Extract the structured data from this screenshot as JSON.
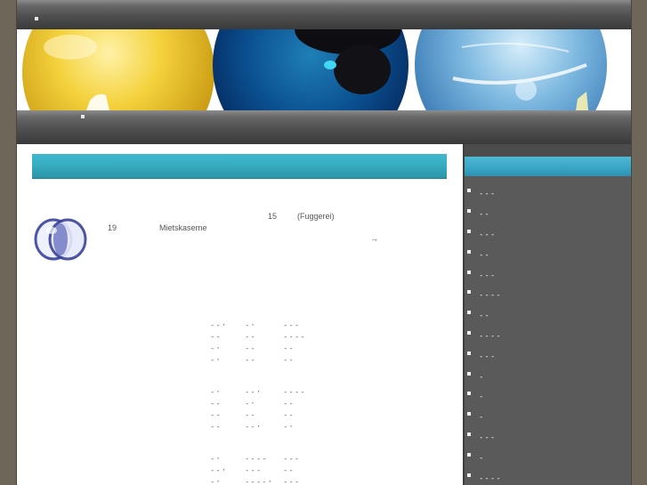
{
  "header": {
    "nav_item": "",
    "banner_alt": "decorative glass spheres"
  },
  "nav": {
    "item": ""
  },
  "post": {
    "date_number": "15",
    "place": "(Fuggerei)",
    "year_prefix": "19",
    "word": "Mietskaserne",
    "more_arrow": "→"
  },
  "tables": [
    {
      "rows": [
        [
          "--·",
          "-·",
          "---"
        ],
        [
          "--",
          "--",
          "----"
        ],
        [
          "-·",
          "--",
          "--"
        ],
        [
          "-·",
          "--",
          "--"
        ]
      ]
    },
    {
      "rows": [
        [
          "-·",
          "--·",
          "----"
        ],
        [
          "--",
          "-·",
          "--"
        ],
        [
          "--",
          "--",
          "--"
        ],
        [
          "--",
          "--·",
          "-·"
        ]
      ]
    },
    {
      "rows": [
        [
          "-·",
          "----",
          "---"
        ],
        [
          "--·",
          "---",
          "--"
        ],
        [
          "-·",
          "----·",
          "---"
        ]
      ]
    }
  ],
  "sidebar": {
    "items": [
      {
        "label": "---"
      },
      {
        "label": "--"
      },
      {
        "label": "---"
      },
      {
        "label": "--"
      },
      {
        "label": "---"
      },
      {
        "label": "----"
      },
      {
        "label": "--"
      },
      {
        "label": "----"
      },
      {
        "label": "---"
      },
      {
        "label": "-"
      },
      {
        "label": "-"
      },
      {
        "label": "-"
      },
      {
        "label": "---"
      },
      {
        "label": "-"
      },
      {
        "label": "----"
      }
    ]
  },
  "colors": {
    "bar_dark": "#3a3a3a",
    "header_teal": "#36a9bd",
    "sidebar_bg": "#5a5a5a",
    "sidebar_header": "#3aa4c5",
    "outer_bg": "#6e6658"
  }
}
